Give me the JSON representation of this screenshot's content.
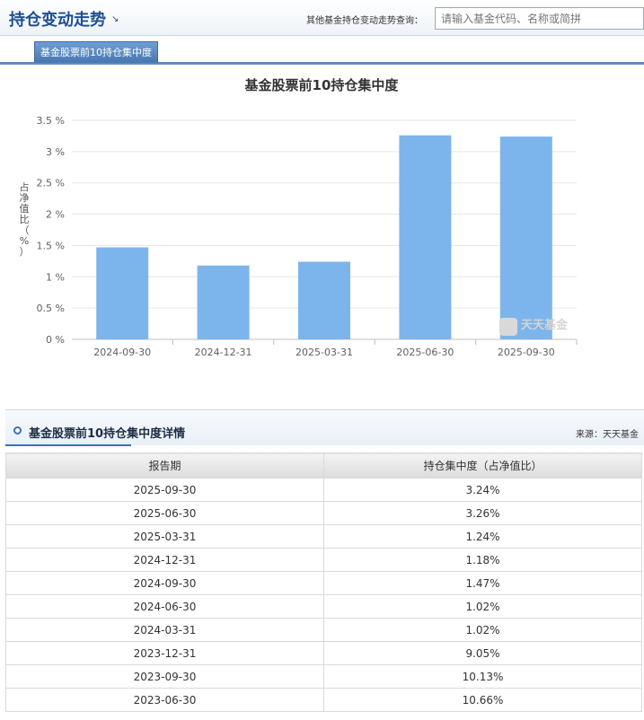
{
  "header": {
    "title": "持仓变动走势",
    "arrow": "↘",
    "search_label": "其他基金持仓变动走势查询：",
    "search_placeholder": "请输入基金代码、名称或简拼"
  },
  "tab": {
    "label": "基金股票前10持仓集中度"
  },
  "chart_data": {
    "type": "bar",
    "title": "基金股票前10持仓集中度",
    "ylabel": "占净值比（%）",
    "ylabel_chars": [
      "占",
      "净",
      "值",
      "比",
      "（",
      "%",
      "）"
    ],
    "categories": [
      "2024-09-30",
      "2024-12-31",
      "2025-03-31",
      "2025-06-30",
      "2025-09-30"
    ],
    "values": [
      1.47,
      1.18,
      1.24,
      3.26,
      3.24
    ],
    "ylim": [
      0,
      3.5
    ],
    "yticks": [
      0,
      0.5,
      1,
      1.5,
      2,
      2.5,
      3,
      3.5
    ],
    "ytick_labels": [
      "0 %",
      "0.5 %",
      "1 %",
      "1.5 %",
      "2 %",
      "2.5 %",
      "3 %",
      "3.5 %"
    ],
    "grid": true,
    "bar_color": "#7cb5ec",
    "watermark": "天天基金"
  },
  "details": {
    "title": "基金股票前10持仓集中度详情",
    "source": "来源：天天基金",
    "columns": [
      "报告期",
      "持仓集中度（占净值比）"
    ],
    "rows": [
      [
        "2025-09-30",
        "3.24%"
      ],
      [
        "2025-06-30",
        "3.26%"
      ],
      [
        "2025-03-31",
        "1.24%"
      ],
      [
        "2024-12-31",
        "1.18%"
      ],
      [
        "2024-09-30",
        "1.47%"
      ],
      [
        "2024-06-30",
        "1.02%"
      ],
      [
        "2024-03-31",
        "1.02%"
      ],
      [
        "2023-12-31",
        "9.05%"
      ],
      [
        "2023-09-30",
        "10.13%"
      ],
      [
        "2023-06-30",
        "10.66%"
      ]
    ]
  }
}
